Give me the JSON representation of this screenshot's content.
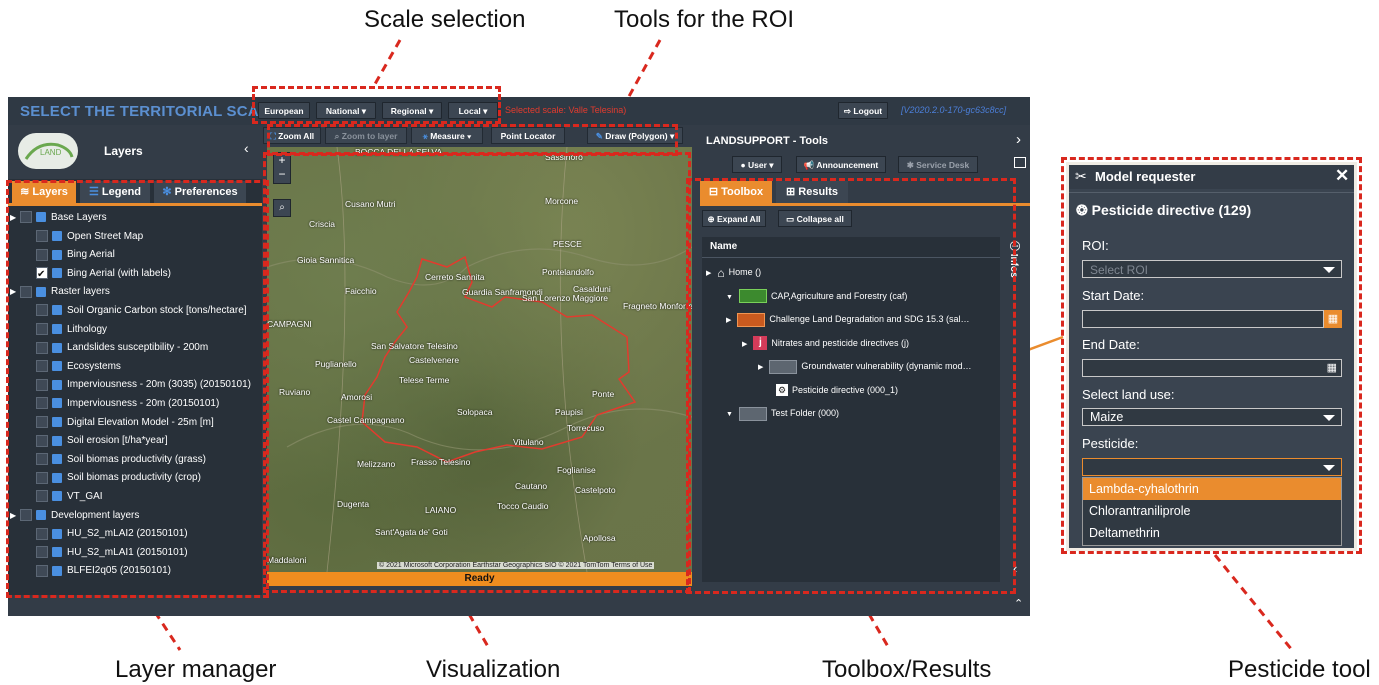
{
  "annotations": {
    "scale_selection": "Scale selection",
    "tools_roi": "Tools for the ROI",
    "layer_manager": "Layer manager",
    "visualization": "Visualization",
    "toolbox_results": "Toolbox/Results",
    "pesticide_tool": "Pesticide tool"
  },
  "topbar": {
    "title": "SELECT THE TERRITORIAL SCALE:",
    "european": "European",
    "national": "National ▾",
    "regional": "Regional ▾",
    "local": "Local ▾",
    "selected_scale": "Selected scale: Valle Telesina)",
    "logout": "Logout",
    "version": "[V2020.2.0-170-gc63c8cc]"
  },
  "left_panel": {
    "logo_text": "LAND",
    "title": "Layers",
    "tabs": [
      "Layers",
      "Legend",
      "Preferences"
    ],
    "items": [
      {
        "label": "Base Layers",
        "kind": "group"
      },
      {
        "label": "Open Street Map",
        "checked": false
      },
      {
        "label": "Bing Aerial",
        "checked": false
      },
      {
        "label": "Bing Aerial (with labels)",
        "checked": true
      },
      {
        "label": "Raster layers",
        "kind": "group"
      },
      {
        "label": "Soil Organic Carbon stock [tons/hectare]",
        "checked": false
      },
      {
        "label": "Lithology",
        "checked": false
      },
      {
        "label": "Landslides susceptibility - 200m",
        "checked": false
      },
      {
        "label": "Ecosystems",
        "checked": false
      },
      {
        "label": "Imperviousness - 20m (3035) (20150101)",
        "checked": false
      },
      {
        "label": "Imperviousness - 20m (20150101)",
        "checked": false
      },
      {
        "label": "Digital Elevation Model - 25m [m]",
        "checked": false
      },
      {
        "label": "Soil erosion [t/ha*year]",
        "checked": false
      },
      {
        "label": "Soil biomas productivity (grass)",
        "checked": false
      },
      {
        "label": "Soil biomas productivity (crop)",
        "checked": false
      },
      {
        "label": "VT_GAI",
        "checked": false
      },
      {
        "label": "Development layers",
        "kind": "group"
      },
      {
        "label": "HU_S2_mLAI2 (20150101)",
        "checked": false
      },
      {
        "label": "HU_S2_mLAI1 (20150101)",
        "checked": false
      },
      {
        "label": "BLFEI2q05 (20150101)",
        "checked": false
      }
    ]
  },
  "map_toolbar": {
    "zoom_all": "Zoom All",
    "zoom_layer": "Zoom to layer",
    "measure": "Measure",
    "point_locator": "Point Locator",
    "draw": "Draw (Polygon)"
  },
  "map": {
    "places": [
      "BOCCA DELLA SELVA",
      "Sassinoro",
      "Cusano Mutri",
      "Morcone",
      "Criscia",
      "PESCE",
      "Gioia Sannitica",
      "Cerreto Sannita",
      "Pontelandolfo",
      "Faicchio",
      "Guardia Sanframondi",
      "San Lorenzo Maggiore",
      "Casalduni",
      "Fragneto Monforte",
      "CAMPAGNI",
      "San Salvatore Telesino",
      "Castelvenere",
      "Puglianello",
      "Telese Terme",
      "Ruviano",
      "Amorosi",
      "Ponte",
      "Solopaca",
      "Paupisi",
      "Torrecuso",
      "Castel Campagnano",
      "Vitulano",
      "Melizzano",
      "Frasso Telesino",
      "Foglianise",
      "Dugenta",
      "Cautano",
      "Castelpoto",
      "LAIANO",
      "Tocco Caudio",
      "Sant'Agata de' Goti",
      "Apollosa",
      "Maddaloni"
    ],
    "copyright": "© 2021 Microsoft Corporation Earthstar Geographics SIO © 2021 TomTom Terms of Use",
    "status": "Ready",
    "zoom_in": "+",
    "zoom_out": "−"
  },
  "right_panel": {
    "title": "LANDSUPPORT - Tools",
    "user": "User ▾",
    "announcement": "Announcement",
    "service_desk": "Service Desk",
    "tabs": [
      "Toolbox",
      "Results"
    ],
    "expand_all": "Expand All",
    "collapse_all": "Collapse all",
    "column_header": "Name",
    "infos": "Infos",
    "tree": [
      "Home ()",
      "CAP,Agriculture and Forestry (caf)",
      "Challenge Land Degradation and SDG 15.3 (sal…",
      "Nitrates and pesticide directives (j)",
      "Groundwater vulnerability (dynamic mod…",
      "Pesticide directive (000_1)",
      "Test Folder (000)"
    ]
  },
  "model_requester": {
    "title": "Model requester",
    "subtitle": "Pesticide directive (129)",
    "roi_label": "ROI:",
    "roi_placeholder": "Select ROI",
    "start_label": "Start Date:",
    "end_label": "End Date:",
    "land_use_label": "Select land use:",
    "land_use_value": "Maize",
    "pesticide_label": "Pesticide:",
    "options": [
      "Lambda-cyhalothrin",
      "Chlorantraniliprole",
      "Deltamethrin"
    ]
  },
  "colors": {
    "accent": "#ea8c2e",
    "annotation": "#d9281e",
    "panel": "#283039",
    "header": "#333c47",
    "title_blue": "#5b8fd0"
  }
}
